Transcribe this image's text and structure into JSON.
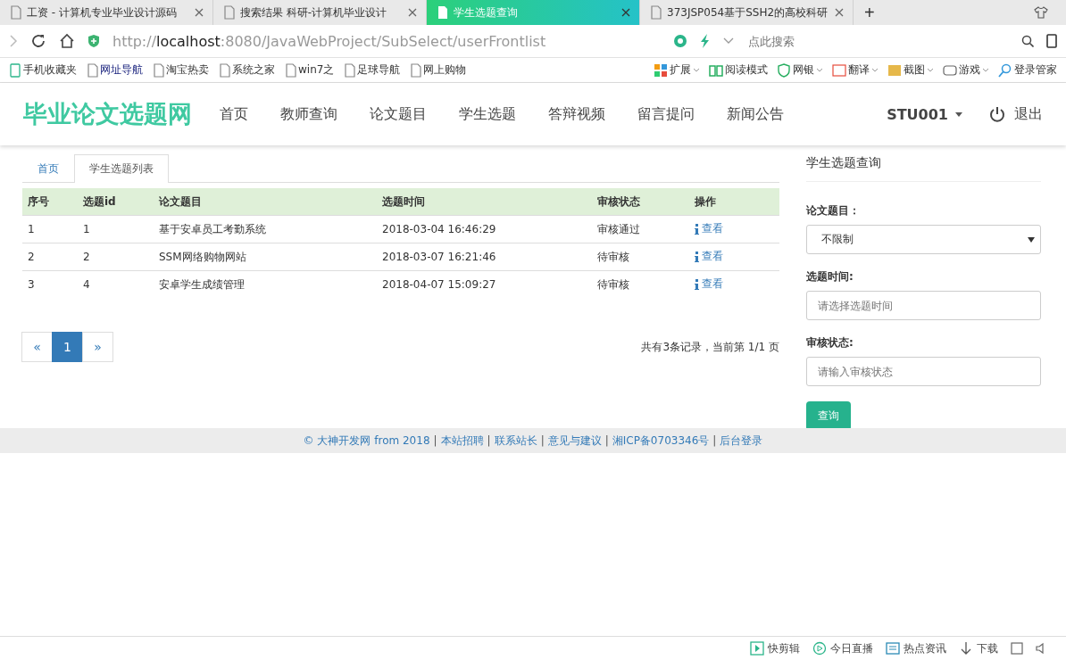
{
  "browser": {
    "tabs": [
      {
        "label": "工资 - 计算机专业毕业设计源码",
        "selected": false
      },
      {
        "label": "搜索结果 科研-计算机毕业设计",
        "selected": false
      },
      {
        "label": "学生选题查询",
        "selected": true
      },
      {
        "label": "373JSP054基于SSH2的高校科研",
        "selected": false
      }
    ],
    "new_tab": "+",
    "url": {
      "scheme": "http://",
      "host": "localhost",
      "path": ":8080/JavaWebProject/SubSelect/userFrontlist"
    },
    "search_placeholder": "点此搜索",
    "bookmarks": [
      "手机收藏夹",
      "网址导航",
      "淘宝热卖",
      "系统之家",
      "win7之",
      "足球导航",
      "网上购物"
    ],
    "tools": [
      {
        "label": "扩展",
        "dropdown": true
      },
      {
        "label": "阅读模式",
        "dropdown": false
      },
      {
        "label": "网银",
        "dropdown": true
      },
      {
        "label": "翻译",
        "dropdown": true
      },
      {
        "label": "截图",
        "dropdown": true
      },
      {
        "label": "游戏",
        "dropdown": true
      },
      {
        "label": "登录管家",
        "dropdown": false
      }
    ]
  },
  "site": {
    "logo": "毕业论文选题网",
    "nav": [
      "首页",
      "教师查询",
      "论文题目",
      "学生选题",
      "答辩视频",
      "留言提问",
      "新闻公告"
    ],
    "user": "STU001",
    "logout": "退出"
  },
  "breadcrumb_tabs": [
    {
      "label": "首页",
      "selected": false
    },
    {
      "label": "学生选题列表",
      "selected": true
    }
  ],
  "table": {
    "columns": [
      "序号",
      "选题id",
      "论文题目",
      "选题时间",
      "审核状态",
      "操作"
    ],
    "rows": [
      {
        "cells": [
          "1",
          "1",
          "基于安卓员工考勤系统",
          "2018-03-04 16:46:29",
          "审核通过"
        ],
        "action": "查看"
      },
      {
        "cells": [
          "2",
          "2",
          "SSM网络购物网站",
          "2018-03-07 16:21:46",
          "待审核"
        ],
        "action": "查看"
      },
      {
        "cells": [
          "3",
          "4",
          "安卓学生成绩管理",
          "2018-04-07 15:09:27",
          "待审核"
        ],
        "action": "查看"
      }
    ]
  },
  "pagination": {
    "prev": "«",
    "pages": [
      {
        "label": "1",
        "selected": true
      }
    ],
    "next": "»",
    "summary": "共有3条记录，当前第 1/1 页"
  },
  "sidebar": {
    "title": "学生选题查询",
    "fields": [
      {
        "kind": "select",
        "label": "论文题目：",
        "value": "不限制"
      },
      {
        "kind": "input",
        "label": "选题时间:",
        "placeholder": "请选择选题时间"
      },
      {
        "kind": "input",
        "label": "审核状态:",
        "placeholder": "请输入审核状态"
      }
    ],
    "button": "查询"
  },
  "footer": {
    "copyright": "© 大神开发网 from 2018",
    "separator": "|",
    "links": [
      "本站招聘",
      "联系站长",
      "意见与建议",
      "湘ICP备0703346号",
      "后台登录"
    ]
  },
  "status_bar": [
    "快剪辑",
    "今日直播",
    "热点资讯",
    "下载"
  ]
}
